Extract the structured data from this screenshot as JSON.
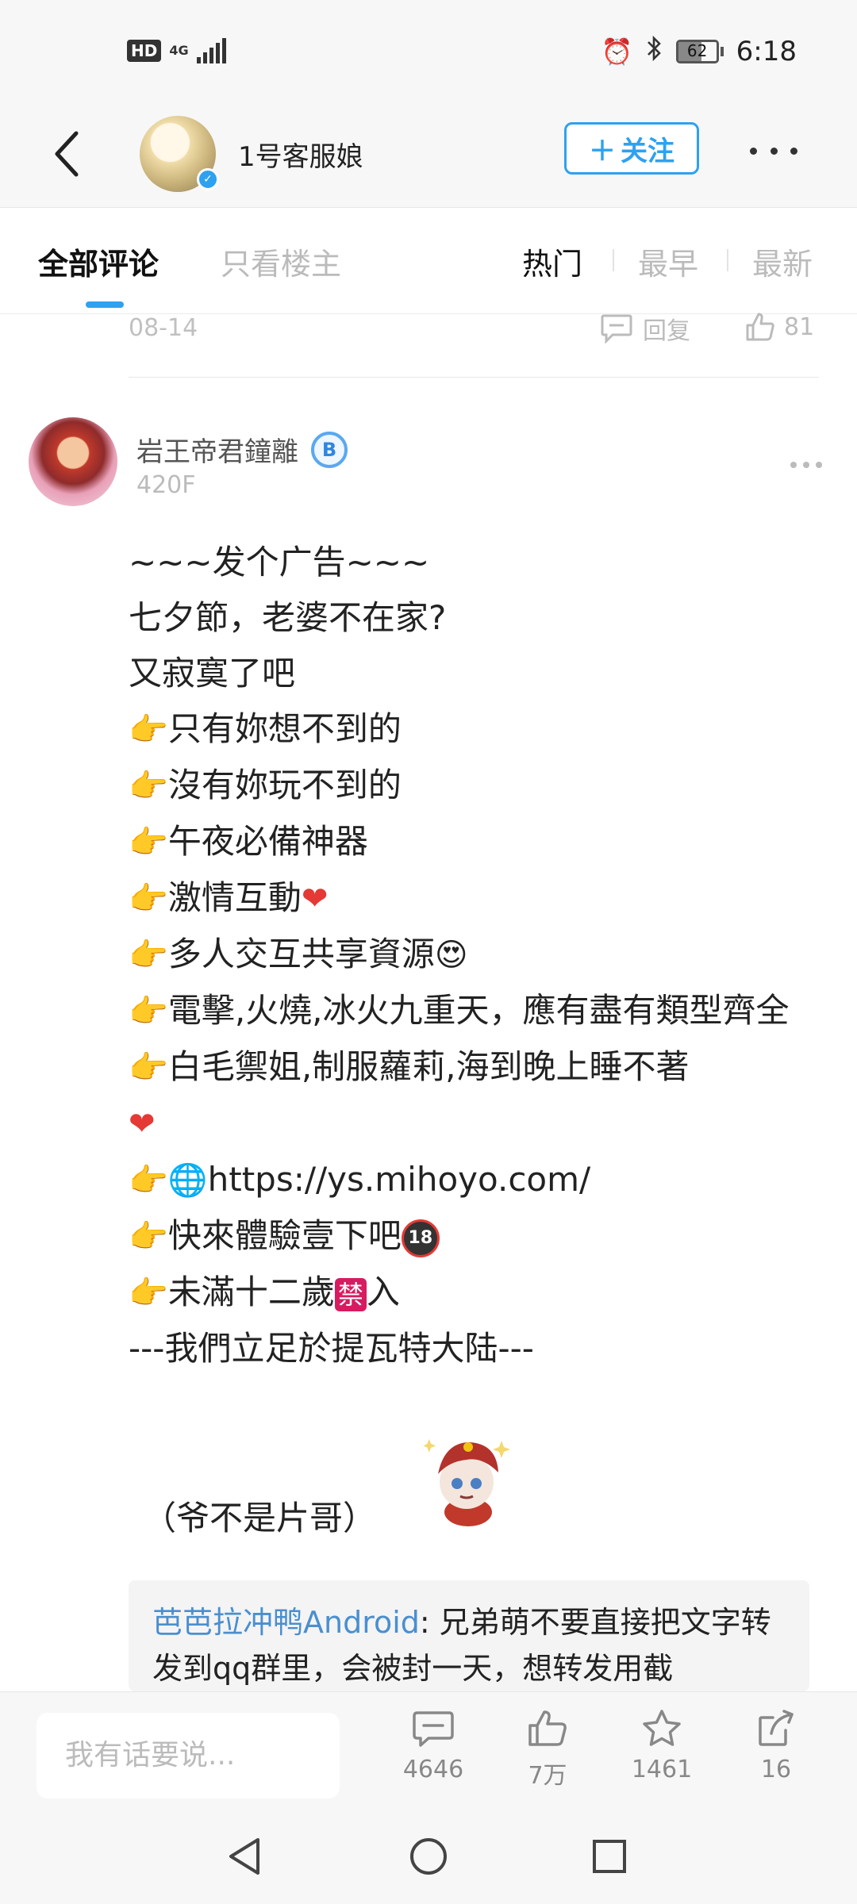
{
  "status_bar": {
    "hd": "HD",
    "network": "4G",
    "time": "6:18",
    "battery": "62"
  },
  "header": {
    "title": "1号客服娘",
    "follow_label": "关注",
    "avatar_icon": "paimon-avatar",
    "accent": "#2ea1f0"
  },
  "tabs": {
    "all": "全部评论",
    "owner_only": "只看楼主",
    "sort_hot": "热门",
    "sort_early": "最早",
    "sort_new": "最新"
  },
  "prev_comment": {
    "date": "08-14",
    "reply_label": "回复",
    "likes": "81"
  },
  "comment": {
    "username": "岩王帝君鐘離",
    "level_badge": "B",
    "floor": "420F",
    "lines": [
      "~~~发个广告~~~",
      "七夕節，老婆不在家?",
      "又寂寞了吧",
      "只有妳想不到的",
      "沒有妳玩不到的",
      "午夜必備神器",
      "激情互動",
      "多人交互共享資源",
      "電擊,火燒,冰火九重天，應有盡有類型齊全",
      "白毛禦姐,制服蘿莉,海到晚上睡不著",
      "https://ys.mihoyo.com/",
      "快來體驗壹下吧",
      "未滿十二歲",
      "入",
      "---我們立足於提瓦特大陆---"
    ],
    "forbid_char": "禁",
    "no18_label": "18",
    "sticker_caption": "（爷不是片哥）"
  },
  "reply": {
    "user": "芭芭拉冲鸭Android",
    "text": ": 兄弟萌不要直接把文字转发到qq群里，会被封一天，想转发用截"
  },
  "bottom_bar": {
    "placeholder": "我有话要说...",
    "comments": "4646",
    "likes": "7万",
    "stars": "1461",
    "shares": "16"
  }
}
